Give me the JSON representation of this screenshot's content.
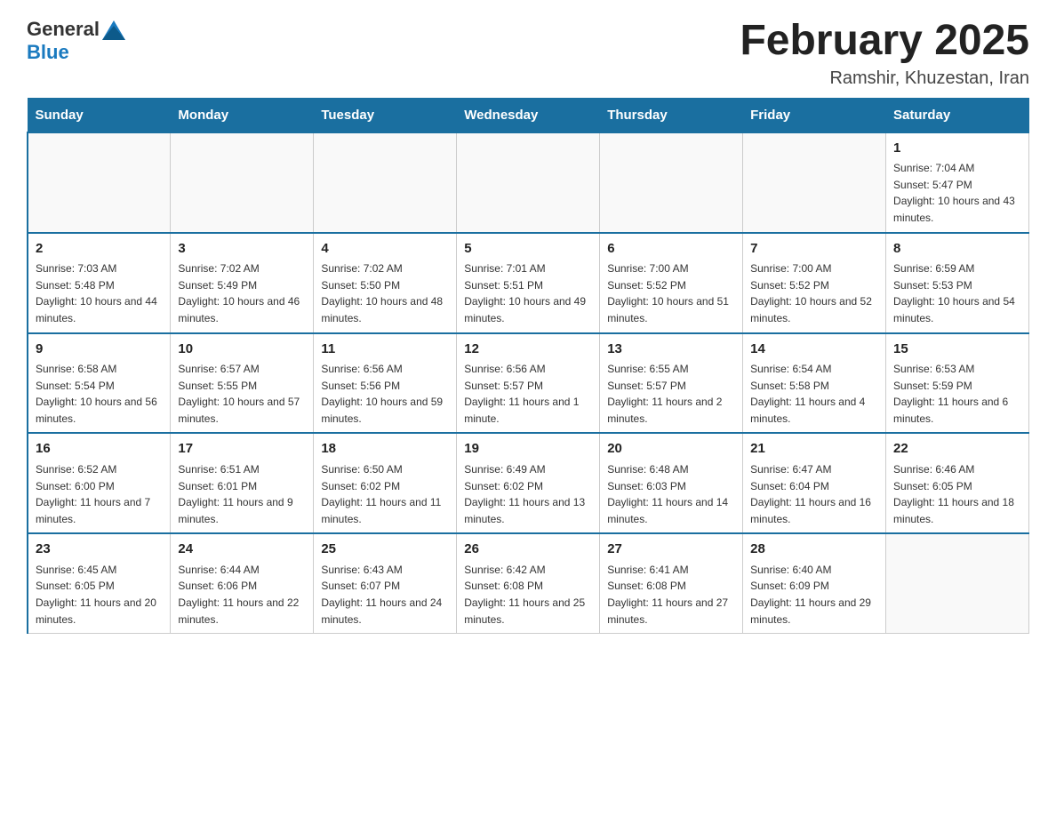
{
  "header": {
    "logo_general": "General",
    "logo_blue": "Blue",
    "month_title": "February 2025",
    "location": "Ramshir, Khuzestan, Iran"
  },
  "days_of_week": [
    "Sunday",
    "Monday",
    "Tuesday",
    "Wednesday",
    "Thursday",
    "Friday",
    "Saturday"
  ],
  "weeks": [
    [
      {
        "day": "",
        "info": ""
      },
      {
        "day": "",
        "info": ""
      },
      {
        "day": "",
        "info": ""
      },
      {
        "day": "",
        "info": ""
      },
      {
        "day": "",
        "info": ""
      },
      {
        "day": "",
        "info": ""
      },
      {
        "day": "1",
        "info": "Sunrise: 7:04 AM\nSunset: 5:47 PM\nDaylight: 10 hours and 43 minutes."
      }
    ],
    [
      {
        "day": "2",
        "info": "Sunrise: 7:03 AM\nSunset: 5:48 PM\nDaylight: 10 hours and 44 minutes."
      },
      {
        "day": "3",
        "info": "Sunrise: 7:02 AM\nSunset: 5:49 PM\nDaylight: 10 hours and 46 minutes."
      },
      {
        "day": "4",
        "info": "Sunrise: 7:02 AM\nSunset: 5:50 PM\nDaylight: 10 hours and 48 minutes."
      },
      {
        "day": "5",
        "info": "Sunrise: 7:01 AM\nSunset: 5:51 PM\nDaylight: 10 hours and 49 minutes."
      },
      {
        "day": "6",
        "info": "Sunrise: 7:00 AM\nSunset: 5:52 PM\nDaylight: 10 hours and 51 minutes."
      },
      {
        "day": "7",
        "info": "Sunrise: 7:00 AM\nSunset: 5:52 PM\nDaylight: 10 hours and 52 minutes."
      },
      {
        "day": "8",
        "info": "Sunrise: 6:59 AM\nSunset: 5:53 PM\nDaylight: 10 hours and 54 minutes."
      }
    ],
    [
      {
        "day": "9",
        "info": "Sunrise: 6:58 AM\nSunset: 5:54 PM\nDaylight: 10 hours and 56 minutes."
      },
      {
        "day": "10",
        "info": "Sunrise: 6:57 AM\nSunset: 5:55 PM\nDaylight: 10 hours and 57 minutes."
      },
      {
        "day": "11",
        "info": "Sunrise: 6:56 AM\nSunset: 5:56 PM\nDaylight: 10 hours and 59 minutes."
      },
      {
        "day": "12",
        "info": "Sunrise: 6:56 AM\nSunset: 5:57 PM\nDaylight: 11 hours and 1 minute."
      },
      {
        "day": "13",
        "info": "Sunrise: 6:55 AM\nSunset: 5:57 PM\nDaylight: 11 hours and 2 minutes."
      },
      {
        "day": "14",
        "info": "Sunrise: 6:54 AM\nSunset: 5:58 PM\nDaylight: 11 hours and 4 minutes."
      },
      {
        "day": "15",
        "info": "Sunrise: 6:53 AM\nSunset: 5:59 PM\nDaylight: 11 hours and 6 minutes."
      }
    ],
    [
      {
        "day": "16",
        "info": "Sunrise: 6:52 AM\nSunset: 6:00 PM\nDaylight: 11 hours and 7 minutes."
      },
      {
        "day": "17",
        "info": "Sunrise: 6:51 AM\nSunset: 6:01 PM\nDaylight: 11 hours and 9 minutes."
      },
      {
        "day": "18",
        "info": "Sunrise: 6:50 AM\nSunset: 6:02 PM\nDaylight: 11 hours and 11 minutes."
      },
      {
        "day": "19",
        "info": "Sunrise: 6:49 AM\nSunset: 6:02 PM\nDaylight: 11 hours and 13 minutes."
      },
      {
        "day": "20",
        "info": "Sunrise: 6:48 AM\nSunset: 6:03 PM\nDaylight: 11 hours and 14 minutes."
      },
      {
        "day": "21",
        "info": "Sunrise: 6:47 AM\nSunset: 6:04 PM\nDaylight: 11 hours and 16 minutes."
      },
      {
        "day": "22",
        "info": "Sunrise: 6:46 AM\nSunset: 6:05 PM\nDaylight: 11 hours and 18 minutes."
      }
    ],
    [
      {
        "day": "23",
        "info": "Sunrise: 6:45 AM\nSunset: 6:05 PM\nDaylight: 11 hours and 20 minutes."
      },
      {
        "day": "24",
        "info": "Sunrise: 6:44 AM\nSunset: 6:06 PM\nDaylight: 11 hours and 22 minutes."
      },
      {
        "day": "25",
        "info": "Sunrise: 6:43 AM\nSunset: 6:07 PM\nDaylight: 11 hours and 24 minutes."
      },
      {
        "day": "26",
        "info": "Sunrise: 6:42 AM\nSunset: 6:08 PM\nDaylight: 11 hours and 25 minutes."
      },
      {
        "day": "27",
        "info": "Sunrise: 6:41 AM\nSunset: 6:08 PM\nDaylight: 11 hours and 27 minutes."
      },
      {
        "day": "28",
        "info": "Sunrise: 6:40 AM\nSunset: 6:09 PM\nDaylight: 11 hours and 29 minutes."
      },
      {
        "day": "",
        "info": ""
      }
    ]
  ]
}
